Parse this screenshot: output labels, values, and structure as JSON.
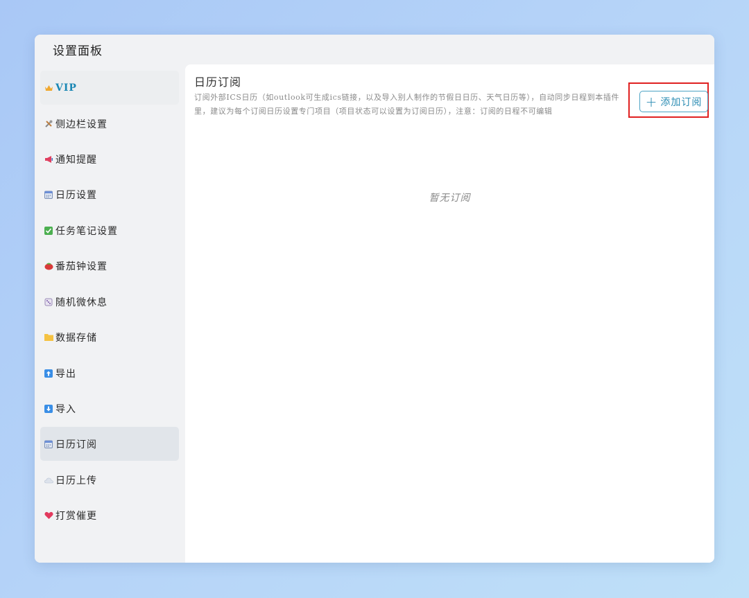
{
  "window": {
    "title": "设置面板"
  },
  "sidebar": {
    "items": [
      {
        "label": "VIP",
        "icon": "crown-icon"
      },
      {
        "label": "侧边栏设置",
        "icon": "tools-icon"
      },
      {
        "label": "通知提醒",
        "icon": "megaphone-icon"
      },
      {
        "label": "日历设置",
        "icon": "calendar-icon"
      },
      {
        "label": "任务笔记设置",
        "icon": "check-box-icon"
      },
      {
        "label": "番茄钟设置",
        "icon": "tomato-icon"
      },
      {
        "label": "随机微休息",
        "icon": "dice-icon"
      },
      {
        "label": "数据存储",
        "icon": "folder-icon"
      },
      {
        "label": "导出",
        "icon": "arrow-up-icon"
      },
      {
        "label": "导入",
        "icon": "arrow-down-icon"
      },
      {
        "label": "日历订阅",
        "icon": "calendar-icon"
      },
      {
        "label": "日历上传",
        "icon": "cloud-icon"
      },
      {
        "label": "打赏催更",
        "icon": "heart-icon"
      }
    ],
    "active": "日历订阅"
  },
  "main": {
    "title": "日历订阅",
    "description": "订阅外部ICS日历（如outlook可生成ics链接，以及导入别人制作的节假日日历、天气日历等），自动同步日程到本插件里，建议为每个订阅日历设置专门项目（项目状态可以设置为订阅日历），注意：订阅的日程不可编辑",
    "add_button_label": "添加订阅",
    "empty_text": "暂无订阅"
  },
  "colors": {
    "accent": "#2b8cb3",
    "highlight": "#e02020"
  }
}
